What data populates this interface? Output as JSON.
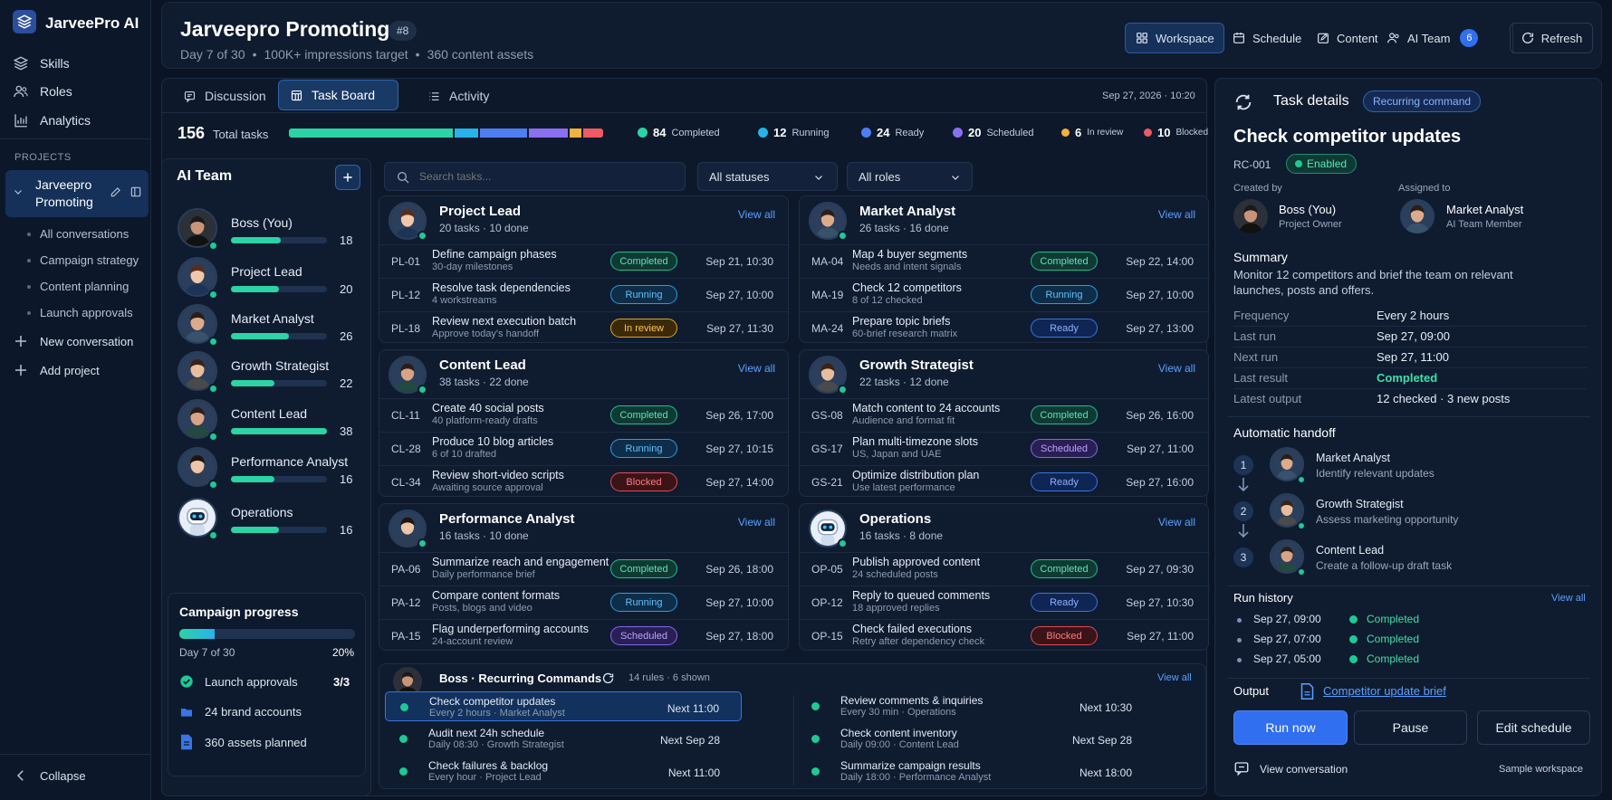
{
  "app": {
    "name": "JarveePro AI"
  },
  "sidebar": {
    "nav": [
      {
        "label": "Skills",
        "icon": "layers-icon"
      },
      {
        "label": "Roles",
        "icon": "users-icon"
      },
      {
        "label": "Analytics",
        "icon": "chart-icon"
      }
    ],
    "section_label": "PROJECTS",
    "project": {
      "name_line1": "Jarveepro",
      "name_line2": "Promoting"
    },
    "subitems": [
      "All conversations",
      "Campaign strategy",
      "Content planning",
      "Launch approvals"
    ],
    "new_conversation": "New conversation",
    "add_project": "Add project",
    "collapse": "Collapse"
  },
  "header": {
    "title": "Jarveepro Promoting",
    "badge": "#8",
    "meta": [
      "Day 7 of 30",
      "100K+ impressions target",
      "360 content assets"
    ],
    "buttons": {
      "workspace": "Workspace",
      "schedule": "Schedule",
      "content": "Content",
      "ai_team": "AI Team",
      "ai_team_count": "6",
      "refresh": "Refresh"
    }
  },
  "tabs": {
    "discussion": "Discussion",
    "task_board": "Task Board",
    "activity": "Activity",
    "datetime": "Sep 27, 2026 · 10:20"
  },
  "summary": {
    "total": "156",
    "total_label": "Total tasks",
    "segments": [
      {
        "label": "Completed",
        "value": 84,
        "color": "#2cd3a5"
      },
      {
        "label": "Running",
        "value": 12,
        "color": "#28b2ea"
      },
      {
        "label": "Ready",
        "value": 24,
        "color": "#4d7ff2"
      },
      {
        "label": "Scheduled",
        "value": 20,
        "color": "#8a6ff0"
      },
      {
        "label": "In review",
        "value": 6,
        "color": "#f1b13a"
      },
      {
        "label": "Blocked",
        "value": 10,
        "color": "#ef5a63"
      }
    ]
  },
  "team": {
    "title": "AI Team",
    "members": [
      {
        "name": "Boss (You)",
        "count": "18",
        "progress": 0.52
      },
      {
        "name": "Project Lead",
        "count": "20",
        "progress": 0.5
      },
      {
        "name": "Market Analyst",
        "count": "26",
        "progress": 0.6
      },
      {
        "name": "Growth Strategist",
        "count": "22",
        "progress": 0.45
      },
      {
        "name": "Content Lead",
        "count": "38",
        "progress": 1.0
      },
      {
        "name": "Performance Analyst",
        "count": "16",
        "progress": 0.45
      },
      {
        "name": "Operations",
        "count": "16",
        "progress": 0.5
      }
    ]
  },
  "campaign": {
    "title": "Campaign progress",
    "progress": 0.2,
    "day": "Day 7 of 30",
    "percent": "20%",
    "items": [
      {
        "label": "Launch approvals",
        "value": "3/3"
      },
      {
        "label": "24 brand accounts",
        "value": ""
      },
      {
        "label": "360 assets planned",
        "value": ""
      }
    ]
  },
  "filters": {
    "search_placeholder": "Search tasks...",
    "status": "All statuses",
    "roles": "All roles"
  },
  "roles": [
    {
      "title": "Project Lead",
      "sub": "20 tasks · 10 done",
      "view": "View all",
      "tasks": [
        {
          "id": "PL-01",
          "name": "Define campaign phases",
          "desc": "30-day milestones",
          "status": "Completed",
          "date": "Sep 21, 10:30"
        },
        {
          "id": "PL-12",
          "name": "Resolve task dependencies",
          "desc": "4 workstreams",
          "status": "Running",
          "date": "Sep 27, 10:00"
        },
        {
          "id": "PL-18",
          "name": "Review next execution batch",
          "desc": "Approve today's handoff",
          "status": "In review",
          "date": "Sep 27, 11:30"
        }
      ]
    },
    {
      "title": "Market Analyst",
      "sub": "26 tasks · 16 done",
      "view": "View all",
      "tasks": [
        {
          "id": "MA-04",
          "name": "Map 4 buyer segments",
          "desc": "Needs and intent signals",
          "status": "Completed",
          "date": "Sep 22, 14:00"
        },
        {
          "id": "MA-19",
          "name": "Check 12 competitors",
          "desc": "8 of 12 checked",
          "status": "Running",
          "date": "Sep 27, 10:00"
        },
        {
          "id": "MA-24",
          "name": "Prepare topic briefs",
          "desc": "60-brief research matrix",
          "status": "Ready",
          "date": "Sep 27, 13:00"
        }
      ]
    },
    {
      "title": "Content Lead",
      "sub": "38 tasks · 22 done",
      "view": "View all",
      "tasks": [
        {
          "id": "CL-11",
          "name": "Create 40 social posts",
          "desc": "40 platform-ready drafts",
          "status": "Completed",
          "date": "Sep 26, 17:00"
        },
        {
          "id": "CL-28",
          "name": "Produce 10 blog articles",
          "desc": "6 of 10 drafted",
          "status": "Running",
          "date": "Sep 27, 10:15"
        },
        {
          "id": "CL-34",
          "name": "Review short-video scripts",
          "desc": "Awaiting source approval",
          "status": "Blocked",
          "date": "Sep 27, 14:00"
        }
      ]
    },
    {
      "title": "Growth Strategist",
      "sub": "22 tasks · 12 done",
      "view": "View all",
      "tasks": [
        {
          "id": "GS-08",
          "name": "Match content to 24 accounts",
          "desc": "Audience and format fit",
          "status": "Completed",
          "date": "Sep 26, 16:00"
        },
        {
          "id": "GS-17",
          "name": "Plan multi-timezone slots",
          "desc": "US, Japan and UAE",
          "status": "Scheduled",
          "date": "Sep 27, 11:00"
        },
        {
          "id": "GS-21",
          "name": "Optimize distribution plan",
          "desc": "Use latest performance",
          "status": "Ready",
          "date": "Sep 27, 16:00"
        }
      ]
    },
    {
      "title": "Performance Analyst",
      "sub": "16 tasks · 10 done",
      "view": "View all",
      "tasks": [
        {
          "id": "PA-06",
          "name": "Summarize reach and engagement",
          "desc": "Daily performance brief",
          "status": "Completed",
          "date": "Sep 26, 18:00"
        },
        {
          "id": "PA-12",
          "name": "Compare content formats",
          "desc": "Posts, blogs and video",
          "status": "Running",
          "date": "Sep 27, 10:00"
        },
        {
          "id": "PA-15",
          "name": "Flag underperforming accounts",
          "desc": "24-account review",
          "status": "Scheduled",
          "date": "Sep 27, 18:00"
        }
      ]
    },
    {
      "title": "Operations",
      "sub": "16 tasks · 8 done",
      "view": "View all",
      "tasks": [
        {
          "id": "OP-05",
          "name": "Publish approved content",
          "desc": "24 scheduled posts",
          "status": "Completed",
          "date": "Sep 27, 09:30"
        },
        {
          "id": "OP-12",
          "name": "Reply to queued comments",
          "desc": "18 approved replies",
          "status": "Ready",
          "date": "Sep 27, 10:30"
        },
        {
          "id": "OP-15",
          "name": "Check failed executions",
          "desc": "Retry after dependency check",
          "status": "Blocked",
          "date": "Sep 27, 11:00"
        }
      ]
    }
  ],
  "recurring": {
    "title": "Boss · Recurring Commands",
    "meta": "14 rules · 6 shown",
    "view": "View all",
    "left": [
      {
        "name": "Check competitor updates",
        "sub": "Every 2 hours · Market Analyst",
        "next": "Next 11:00"
      },
      {
        "name": "Audit next 24h schedule",
        "sub": "Daily 08:30 · Growth Strategist",
        "next": "Next Sep 28"
      },
      {
        "name": "Check failures & backlog",
        "sub": "Every hour · Project Lead",
        "next": "Next 11:00"
      }
    ],
    "right": [
      {
        "name": "Review comments & inquiries",
        "sub": "Every 30 min · Operations",
        "next": "Next 10:30"
      },
      {
        "name": "Check content inventory",
        "sub": "Daily 09:00 · Content Lead",
        "next": "Next Sep 28"
      },
      {
        "name": "Summarize campaign results",
        "sub": "Daily 18:00 · Performance Analyst",
        "next": "Next 18:00"
      }
    ]
  },
  "details": {
    "header": "Task details",
    "badge": "Recurring command",
    "title": "Check competitor updates",
    "id": "RC-001",
    "state": "Enabled",
    "created_by_label": "Created by",
    "created_by": {
      "name": "Boss (You)",
      "role": "Project Owner"
    },
    "assigned_to_label": "Assigned to",
    "assigned_to": {
      "name": "Market Analyst",
      "role": "AI Team Member"
    },
    "summary_label": "Summary",
    "summary_line1": "Monitor 12 competitors and brief the team on relevant",
    "summary_line2": "launches, posts and offers.",
    "fields": [
      {
        "k": "Frequency",
        "v": "Every 2 hours"
      },
      {
        "k": "Last run",
        "v": "Sep 27, 09:00"
      },
      {
        "k": "Next run",
        "v": "Sep 27, 11:00"
      },
      {
        "k": "Last result",
        "v": "Completed"
      },
      {
        "k": "Latest output",
        "v": "12 checked · 3 new posts"
      }
    ],
    "handoff_label": "Automatic handoff",
    "handoff": [
      {
        "num": "1",
        "name": "Market Analyst",
        "desc": "Identify relevant updates"
      },
      {
        "num": "2",
        "name": "Growth Strategist",
        "desc": "Assess marketing opportunity"
      },
      {
        "num": "3",
        "name": "Content Lead",
        "desc": "Create a follow-up draft task"
      }
    ],
    "history_label": "Run history",
    "history_view": "View all",
    "history": [
      {
        "time": "Sep 27, 09:00",
        "result": "Completed"
      },
      {
        "time": "Sep 27, 07:00",
        "result": "Completed"
      },
      {
        "time": "Sep 27, 05:00",
        "result": "Completed"
      }
    ],
    "output_label": "Output",
    "output_link": "Competitor update brief",
    "buttons": {
      "run": "Run now",
      "pause": "Pause",
      "edit": "Edit schedule"
    },
    "view_conversation": "View conversation",
    "footer": "Sample workspace"
  }
}
